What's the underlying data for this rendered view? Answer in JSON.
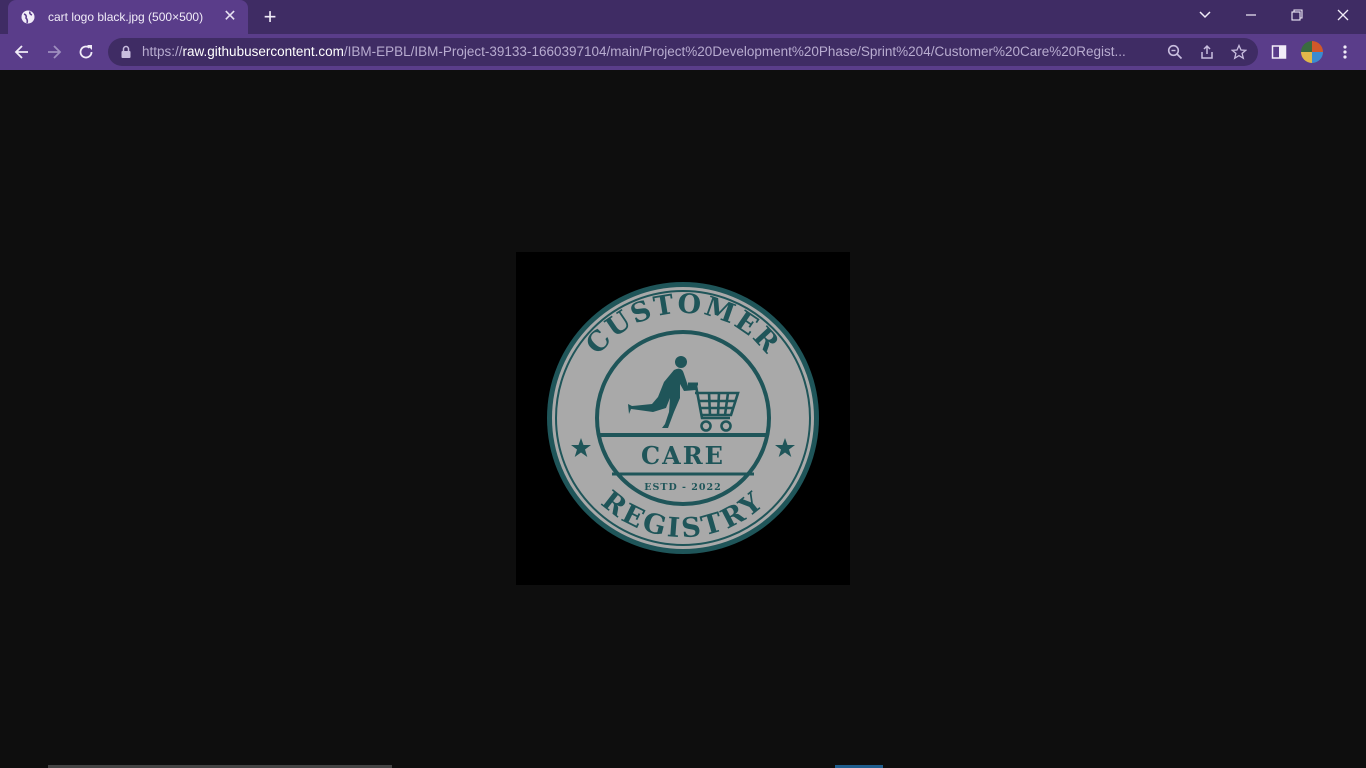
{
  "browser": {
    "tab": {
      "title": "cart logo black.jpg (500×500)"
    },
    "address": {
      "scheme": "https://",
      "host": "raw.githubusercontent.com",
      "path": "/IBM-EPBL/IBM-Project-39133-1660397104/main/Project%20Development%20Phase/Sprint%204/Customer%20Care%20Regist..."
    },
    "colors": {
      "frame": "#3f2c64",
      "toolbar": "#5a3d8a",
      "page": "#0e0e0e"
    }
  },
  "logo": {
    "top_text": "CUSTOMER",
    "center_text": "CARE",
    "estd_text": "ESTD - 2022",
    "bottom_text": "REGISTRY",
    "colors": {
      "ring": "#1f5559",
      "fill": "#a9a9a9"
    }
  }
}
